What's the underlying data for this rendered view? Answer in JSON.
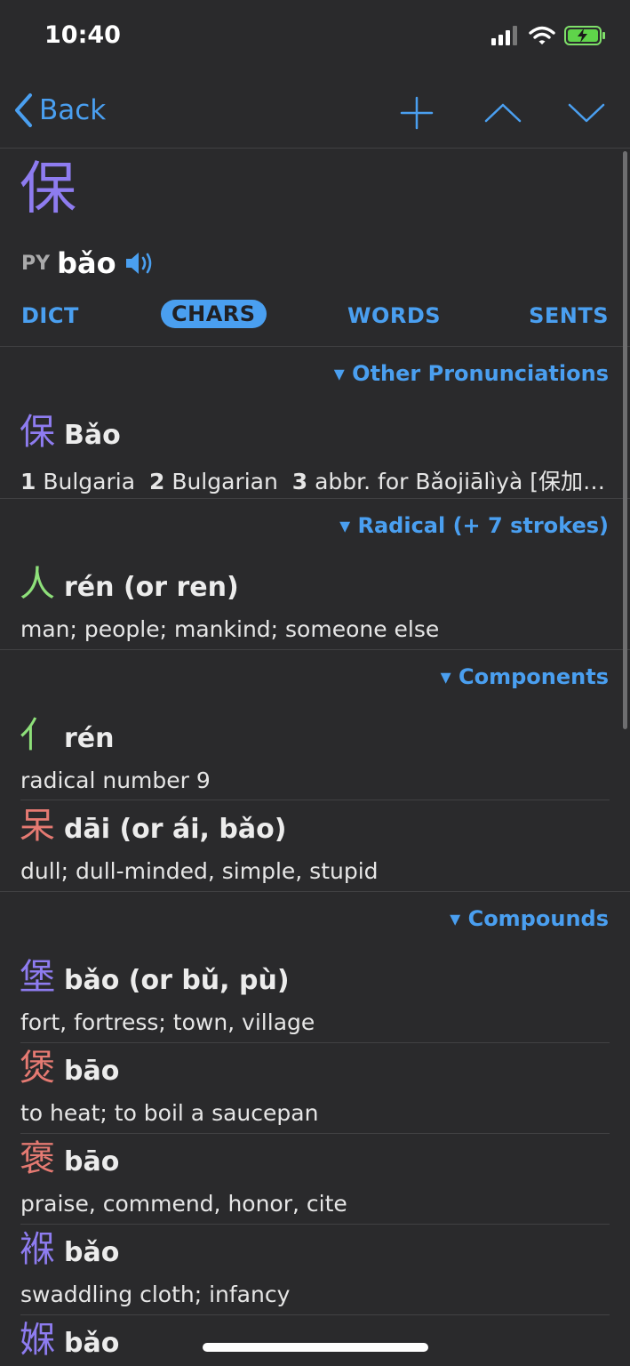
{
  "status_bar": {
    "time": "10:40"
  },
  "nav": {
    "back_label": "Back"
  },
  "headword": {
    "character": "保",
    "py_tag": "PY",
    "pinyin": "bǎo"
  },
  "tabs": [
    {
      "label": "DICT"
    },
    {
      "label": "CHARS",
      "active": true
    },
    {
      "label": "WORDS"
    },
    {
      "label": "SENTS"
    }
  ],
  "sections": {
    "other_pronunciations": "▾ Other Pronunciations",
    "radical": "▾ Radical (+ 7 strokes)",
    "components": "▾ Components",
    "compounds": "▾ Compounds"
  },
  "other_pronunciation": {
    "char": "保",
    "pinyin": "Bǎo",
    "d1n": "1",
    "d1": "Bulgaria",
    "d2n": "2",
    "d2": "Bulgarian",
    "d3n": "3",
    "d3": "abbr. for Bǎojiālìyà [保加…"
  },
  "radical_entry": {
    "char": "人",
    "pinyin": "rén (or ren)",
    "def": "man; people; mankind; someone else"
  },
  "components": [
    {
      "char": "亻",
      "pinyin": "rén",
      "def": "radical number 9"
    },
    {
      "char": "呆",
      "pinyin": "dāi (or ái, bǎo)",
      "def": "dull; dull-minded, simple, stupid"
    }
  ],
  "compounds": [
    {
      "char": "堡",
      "pinyin": "bǎo (or bǔ, pù)",
      "def": "fort, fortress; town, village"
    },
    {
      "char": "煲",
      "pinyin": "bāo",
      "def": "to heat; to boil a saucepan"
    },
    {
      "char": "褒",
      "pinyin": "bāo",
      "def": "praise, commend, honor, cite"
    },
    {
      "char": "褓",
      "pinyin": "bǎo",
      "def": "swaddling cloth; infancy"
    },
    {
      "char": "媬",
      "pinyin": "bǎo",
      "def": ""
    }
  ],
  "colors": {
    "accent": "#4a9ff0",
    "tone1": "#e57a72",
    "tone2": "#8ee07a",
    "tone3": "#8e7cf0"
  }
}
